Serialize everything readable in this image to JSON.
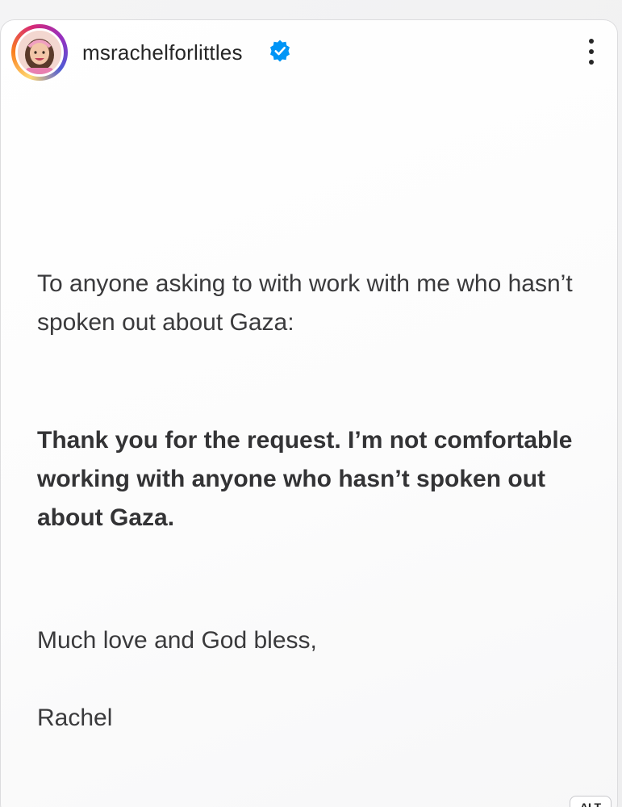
{
  "post": {
    "username": "msrachelforlittles",
    "verified": true,
    "paragraphs": [
      "To anyone asking to with work with me who hasn’t spoken out about Gaza:",
      "Thank you for the request. I’m not comfortable working with anyone who hasn’t spoken out about Gaza.",
      "Much love and God bless,",
      "Rachel"
    ],
    "alt_badge": "ALT"
  },
  "icons": {
    "verified": "verified-badge-icon",
    "more": "more-options-icon",
    "avatar": "avatar"
  },
  "colors": {
    "verified_blue": "#0095f6",
    "text": "#3a3a3c",
    "username": "#262626"
  }
}
